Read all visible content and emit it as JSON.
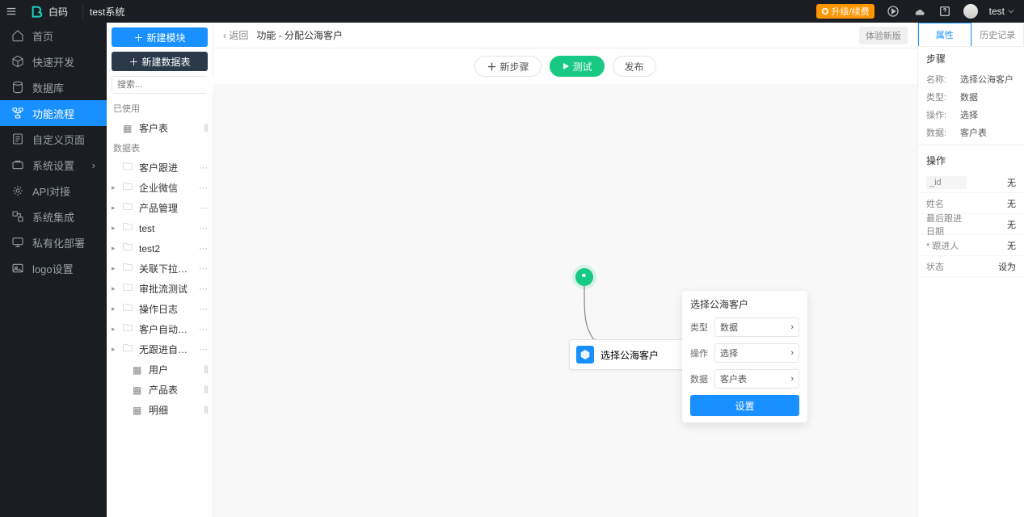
{
  "topbar": {
    "brand": "白码",
    "system": "test系统",
    "upgrade": "✪ 升级/续费",
    "user": "test"
  },
  "leftnav": [
    {
      "icon": "home",
      "label": "首页"
    },
    {
      "icon": "cube",
      "label": "快速开发"
    },
    {
      "icon": "db",
      "label": "数据库"
    },
    {
      "icon": "flow",
      "label": "功能流程",
      "active": true
    },
    {
      "icon": "page",
      "label": "自定义页面"
    },
    {
      "icon": "settings",
      "label": "系统设置",
      "chev": true
    },
    {
      "icon": "api",
      "label": "API对接"
    },
    {
      "icon": "integ",
      "label": "系统集成"
    },
    {
      "icon": "deploy",
      "label": "私有化部署"
    },
    {
      "icon": "logo",
      "label": "logo设置"
    }
  ],
  "secondary": {
    "btn_new_module": "新建模块",
    "btn_new_table": "新建数据表",
    "search_placeholder": "搜索...",
    "used_header": "已使用",
    "used_items": [
      {
        "label": "客户表"
      }
    ],
    "tables_header": "数据表",
    "tables": [
      {
        "label": "客户跟进",
        "folder": true,
        "caret": false
      },
      {
        "label": "企业微信",
        "folder": true,
        "caret": true
      },
      {
        "label": "产品管理",
        "folder": true,
        "caret": true
      },
      {
        "label": "test",
        "folder": true,
        "caret": true
      },
      {
        "label": "test2",
        "folder": true,
        "caret": true
      },
      {
        "label": "关联下拉测试",
        "folder": true,
        "caret": true
      },
      {
        "label": "审批流测试",
        "folder": true,
        "caret": true
      },
      {
        "label": "操作日志",
        "folder": true,
        "caret": true
      },
      {
        "label": "客户自动分配",
        "folder": true,
        "caret": true
      },
      {
        "label": "无跟进自动退回",
        "folder": true,
        "caret": true,
        "children": [
          {
            "label": "用户"
          },
          {
            "label": "产品表"
          },
          {
            "label": "明细"
          }
        ]
      }
    ]
  },
  "main": {
    "back": "返回",
    "title": "功能 - 分配公海客户",
    "version_btn": "体验新版",
    "toolbar": {
      "new_step": "新步骤",
      "test": "测试",
      "publish": "发布"
    },
    "step_node": "选择公海客户",
    "cfg": {
      "title": "选择公海客户",
      "rows": [
        {
          "k": "类型",
          "v": "数据"
        },
        {
          "k": "操作",
          "v": "选择"
        },
        {
          "k": "数据",
          "v": "客户表"
        }
      ],
      "set_btn": "设置"
    }
  },
  "inspector": {
    "tabs": [
      "属性",
      "历史记录"
    ],
    "sect_step": "步骤",
    "kv": [
      {
        "k": "名称:",
        "v": "选择公海客户"
      },
      {
        "k": "类型:",
        "v": "数据"
      },
      {
        "k": "操作:",
        "v": "选择"
      },
      {
        "k": "数据:",
        "v": "客户表"
      }
    ],
    "sect_op": "操作",
    "ops": [
      {
        "k": "_id",
        "v": "无",
        "shaded": true
      },
      {
        "k": "姓名",
        "v": "无"
      },
      {
        "k": "最后跟进日期",
        "v": "无"
      },
      {
        "k": "* 跟进人",
        "v": "无"
      },
      {
        "k": "状态",
        "v": "设为"
      }
    ]
  }
}
